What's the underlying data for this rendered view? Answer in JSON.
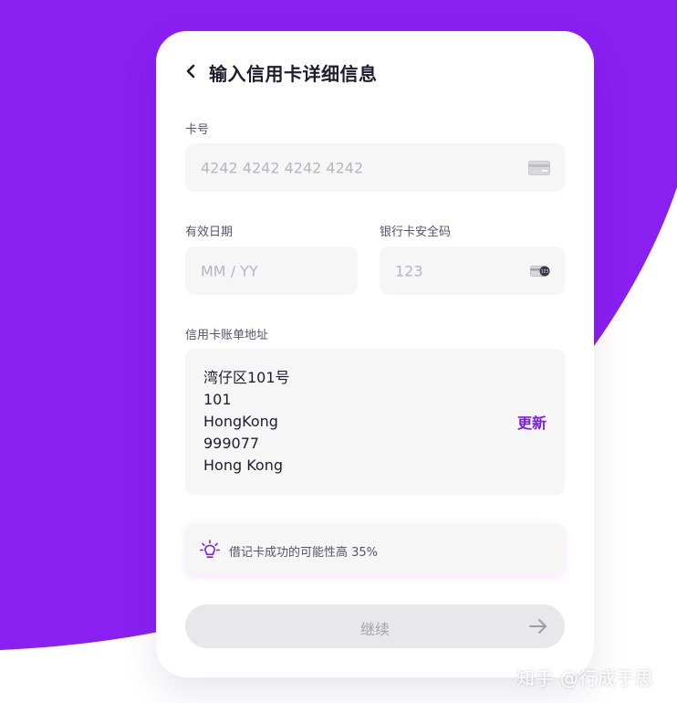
{
  "colors": {
    "brand_purple": "#7a1fe0",
    "background_purple": "#8a1ff2",
    "field_bg": "#f6f6f7",
    "text_dark": "#1f1d2b",
    "text_muted": "#55536a",
    "placeholder": "#b6b6bd",
    "button_disabled_bg": "#e8e8ea"
  },
  "header": {
    "back_icon": "chevron-left-icon",
    "title": "输入信用卡详细信息"
  },
  "card_number": {
    "label": "卡号",
    "placeholder": "4242 4242 4242 4242",
    "icon": "credit-card-icon"
  },
  "expiry": {
    "label": "有效日期",
    "placeholder": "MM / YY"
  },
  "cvc": {
    "label": "银行卡安全码",
    "placeholder": "123",
    "icon": "card-cvc-icon",
    "icon_text": "123"
  },
  "billing_address": {
    "label": "信用卡账单地址",
    "lines": [
      "湾仔区101号",
      "101",
      "HongKong",
      "999077",
      "Hong Kong"
    ],
    "update_label": "更新"
  },
  "tip": {
    "icon": "lightbulb-icon",
    "text": "借记卡成功的可能性高 35%"
  },
  "continue_button": {
    "label": "继续",
    "icon": "arrow-right-icon",
    "disabled": true
  },
  "watermark": "知乎 @行成于思"
}
